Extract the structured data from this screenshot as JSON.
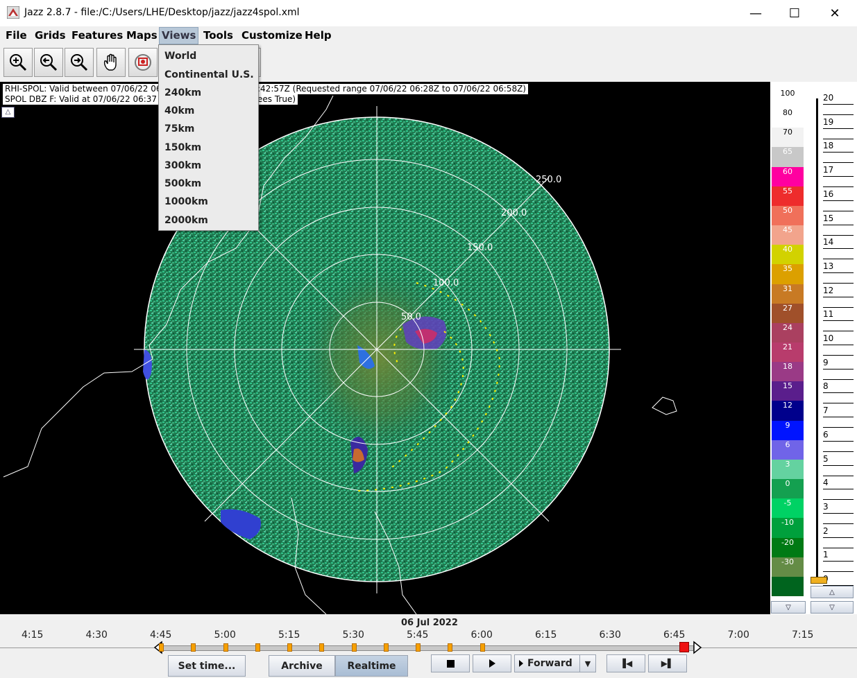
{
  "window": {
    "title": "Jazz 2.8.7 - file:/C:/Users/LHE/Desktop/jazz/jazz4spol.xml",
    "minimize": "—",
    "maximize": "☐",
    "close": "✕"
  },
  "menubar": {
    "items": [
      "File",
      "Grids",
      "Features",
      "Maps",
      "Views",
      "Tools",
      "Customize",
      "Help"
    ],
    "active": "Views"
  },
  "views_menu": {
    "items": [
      "World",
      "Continental U.S.",
      "240km",
      "40km",
      "75km",
      "150km",
      "300km",
      "500km",
      "1000km",
      "2000km"
    ]
  },
  "toolbar": {
    "icons": [
      "zoom-in-icon",
      "zoom-back-icon",
      "zoom-out-icon",
      "pan-hand-icon",
      "layers-icon"
    ]
  },
  "viewport": {
    "info_line1": "RHI-SPOL: Valid between 07/06/22 06",
    "info_line1_right": ":42:57Z (Requested range 07/06/22 06:28Z to 07/06/22 06:58Z)",
    "info_line2": "SPOL DBZ F: Valid at 07/06/22 06:37",
    "info_line2_right": "ees True)",
    "range_labels": [
      "50.0",
      "100.0",
      "150.0",
      "200.0",
      "250.0"
    ]
  },
  "colorbar": {
    "segments": [
      {
        "label": "100",
        "color": "#ffffff",
        "text": "#000000"
      },
      {
        "label": "80",
        "color": "#ffffff",
        "text": "#000000"
      },
      {
        "label": "70",
        "color": "#f2f2f2",
        "text": "#000000"
      },
      {
        "label": "65",
        "color": "#c8c8c8",
        "text": "#ffffff"
      },
      {
        "label": "60",
        "color": "#ff00a0",
        "text": "#ffffff"
      },
      {
        "label": "55",
        "color": "#ee2c2c",
        "text": "#ffffff"
      },
      {
        "label": "50",
        "color": "#f0705a",
        "text": "#ffffff"
      },
      {
        "label": "45",
        "color": "#f2a48c",
        "text": "#ffffff"
      },
      {
        "label": "40",
        "color": "#d2d200",
        "text": "#ffffff"
      },
      {
        "label": "35",
        "color": "#dca000",
        "text": "#ffffff"
      },
      {
        "label": "31",
        "color": "#c87a24",
        "text": "#ffffff"
      },
      {
        "label": "27",
        "color": "#a0502a",
        "text": "#ffffff"
      },
      {
        "label": "24",
        "color": "#aa4060",
        "text": "#ffffff"
      },
      {
        "label": "21",
        "color": "#b83c6c",
        "text": "#ffffff"
      },
      {
        "label": "18",
        "color": "#9a3a86",
        "text": "#ffffff"
      },
      {
        "label": "15",
        "color": "#5a1e8c",
        "text": "#ffffff"
      },
      {
        "label": "12",
        "color": "#00008c",
        "text": "#ffffff"
      },
      {
        "label": "9",
        "color": "#0014ff",
        "text": "#ffffff"
      },
      {
        "label": "6",
        "color": "#7064e8",
        "text": "#ffffff"
      },
      {
        "label": "3",
        "color": "#64d2a0",
        "text": "#ffffff"
      },
      {
        "label": "0",
        "color": "#14a050",
        "text": "#ffffff"
      },
      {
        "label": "-5",
        "color": "#00d264",
        "text": "#ffffff"
      },
      {
        "label": "-10",
        "color": "#00a03c",
        "text": "#ffffff"
      },
      {
        "label": "-20",
        "color": "#007a14",
        "text": "#ffffff"
      },
      {
        "label": "-30",
        "color": "#648c46",
        "text": "#ffffff"
      },
      {
        "label": "",
        "color": "#00641e",
        "text": "#ffffff"
      }
    ]
  },
  "height_scale": {
    "labels": [
      "20",
      "19",
      "18",
      "17",
      "16",
      "15",
      "14",
      "13",
      "12",
      "11",
      "10",
      "9",
      "8",
      "7",
      "6",
      "5",
      "4",
      "3",
      "2",
      "1",
      "0"
    ]
  },
  "timeline": {
    "date": "06 Jul 2022",
    "ticks": [
      "4:15",
      "4:30",
      "4:45",
      "5:00",
      "5:15",
      "5:30",
      "5:45",
      "6:00",
      "6:15",
      "6:30",
      "6:45",
      "7:00",
      "7:15"
    ],
    "buttons": {
      "set_time": "Set time...",
      "archive": "Archive",
      "realtime": "Realtime",
      "forward": "Forward"
    }
  }
}
